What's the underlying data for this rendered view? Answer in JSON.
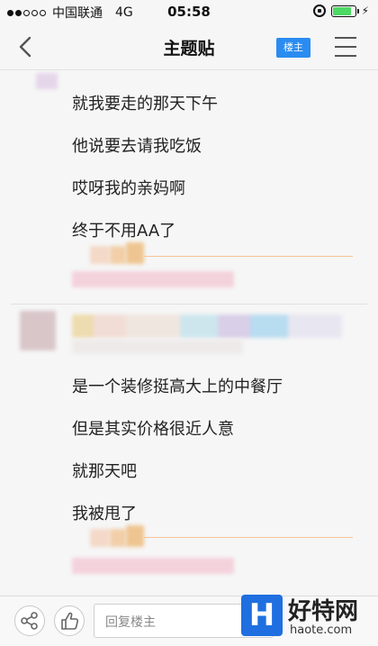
{
  "status_bar": {
    "carrier": "中国联通",
    "network": "4G",
    "time": "05:58"
  },
  "nav": {
    "title": "主题贴",
    "op_label": "楼主"
  },
  "post1": {
    "lines": [
      "就我要走的那天下午",
      "他说要去请我吃饭",
      "哎呀我的亲妈啊",
      "终于不用AA了"
    ]
  },
  "post2": {
    "lines": [
      "是一个装修挺高大上的中餐厅",
      "但是其实价格很近人意",
      "就那天吧",
      "我被甩了"
    ]
  },
  "bottom_bar": {
    "reply_placeholder": "回复楼主"
  },
  "watermark": {
    "name": "好特网",
    "url": "haote.com"
  },
  "colors": {
    "accent": "#2a8cf0",
    "battery": "#4cd964",
    "divider": "#f2c59a"
  }
}
